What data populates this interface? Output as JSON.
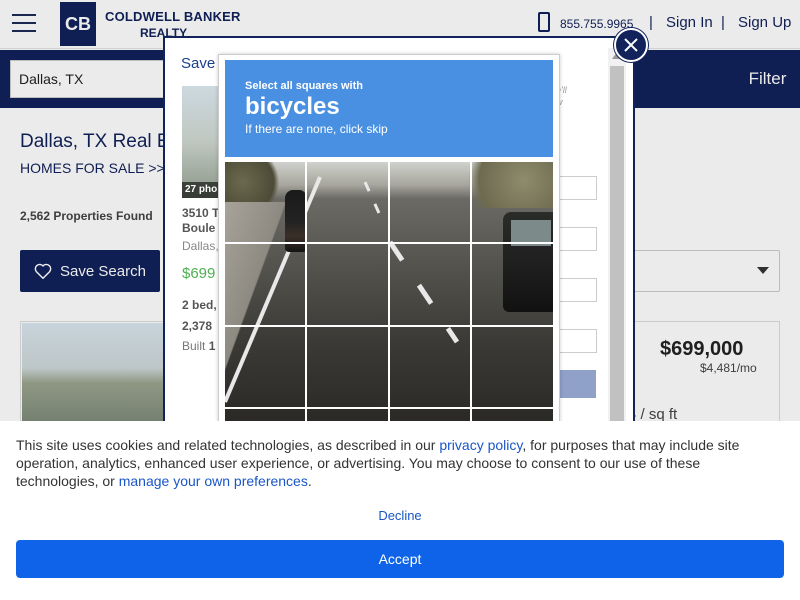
{
  "header": {
    "brand_line1": "COLDWELL BANKER",
    "brand_line2": "REALTY",
    "phone": "855.755.9965",
    "separator": "|",
    "sign_in": "Sign In",
    "sign_up": "Sign Up"
  },
  "search": {
    "value": "Dallas, TX",
    "filter_label": "Filter"
  },
  "page": {
    "title": "Dallas, TX Real E",
    "breadcrumb": "HOMES FOR SALE  >>  C",
    "property_count": "2,562 Properties Found",
    "save_search": "Save Search"
  },
  "listing": {
    "price": "$699,000",
    "per_month": "$4,481/mo",
    "per_sqft": "4 / sq ft"
  },
  "modal": {
    "save_label": "Save",
    "photo_badge": "27 pho",
    "address_line1": "3510 T",
    "address_line2": "Boule",
    "city": "Dallas,",
    "price": "$699",
    "beds": "2 bed,",
    "sqft": "2,378",
    "built_label": "Built",
    "built_value": "1",
    "note_line1": "e'll",
    "note_line2": "w"
  },
  "captcha": {
    "instruction": "Select all squares with",
    "target": "bicycles",
    "skip_hint": "If there are none, click skip"
  },
  "cookie_banner": {
    "text_before_link1": "This site uses cookies and related technologies, as described in our ",
    "link1": "privacy policy",
    "text_middle": ", for purposes that may include site operation, analytics, enhanced user experience, or advertising. You may choose to consent to our use of these technologies, or ",
    "link2": "manage your own preferences",
    "text_end": ".",
    "decline": "Decline",
    "accept": "Accept"
  },
  "colors": {
    "brand_navy": "#12225b",
    "captcha_blue": "#4a90e2",
    "accept_blue": "#0e63e8",
    "link_blue": "#1a56c7",
    "price_green": "#4caf50"
  },
  "icons": [
    "hamburger-menu-icon",
    "phone-icon",
    "heart-icon",
    "chevron-down-icon",
    "close-icon",
    "scroll-up-arrow-icon"
  ]
}
